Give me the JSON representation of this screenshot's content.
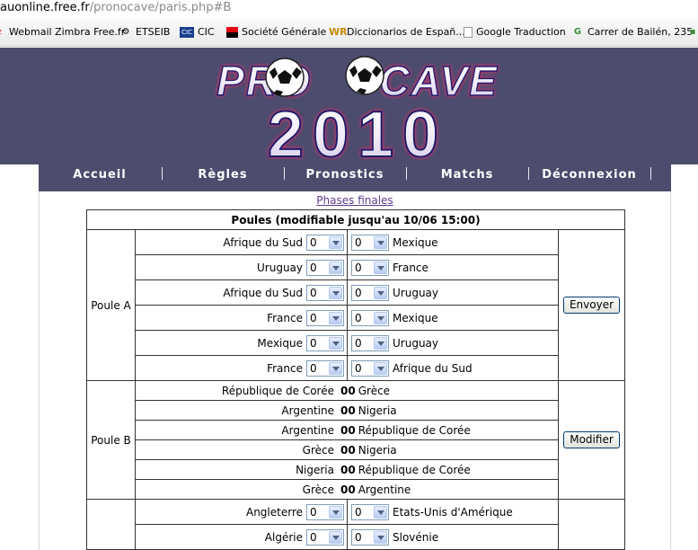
{
  "browser": {
    "url_host": "auonline.free.fr",
    "url_path": "/pronocave/paris.php#B",
    "bookmarks": [
      {
        "label": "Webmail Zimbra Free.fr",
        "icon": "zimbra-icon"
      },
      {
        "label": "ETSEIB",
        "icon": "etseib-icon"
      },
      {
        "label": "CIC",
        "icon": "cic-icon"
      },
      {
        "label": "Société Générale",
        "icon": "societe-generale-icon"
      },
      {
        "label": "Diccionarios de Españ...",
        "icon": "wr-icon"
      },
      {
        "label": "Google Traduction",
        "icon": "page-icon"
      },
      {
        "label": "Carrer de Bailén, 235",
        "icon": "maps-icon"
      }
    ]
  },
  "logo": {
    "line1": "PRONOCAVE",
    "line2": "2010"
  },
  "nav": [
    "Accueil",
    "Règles",
    "Pronostics",
    "Matchs",
    "Déconnexion"
  ],
  "phases_link": "Phases finales",
  "table": {
    "header": "Poules (modifiable jusqu'au 10/06 15:00)",
    "groups": [
      {
        "name": "Poule A",
        "button": "Envoyer",
        "editable": true,
        "matches": [
          {
            "home": "Afrique du Sud",
            "away": "Mexique",
            "h": "0",
            "a": "0"
          },
          {
            "home": "Uruguay",
            "away": "France",
            "h": "0",
            "a": "0"
          },
          {
            "home": "Afrique du Sud",
            "away": "Uruguay",
            "h": "0",
            "a": "0"
          },
          {
            "home": "France",
            "away": "Mexique",
            "h": "0",
            "a": "0"
          },
          {
            "home": "Mexique",
            "away": "Uruguay",
            "h": "0",
            "a": "0"
          },
          {
            "home": "France",
            "away": "Afrique du Sud",
            "h": "0",
            "a": "0"
          }
        ]
      },
      {
        "name": "Poule B",
        "button": "Modifier",
        "editable": false,
        "matches": [
          {
            "home": "République de Corée",
            "away": "Grèce",
            "h": "0",
            "a": "0"
          },
          {
            "home": "Argentine",
            "away": "Nigeria",
            "h": "0",
            "a": "0"
          },
          {
            "home": "Argentine",
            "away": "République de Corée",
            "h": "0",
            "a": "0"
          },
          {
            "home": "Grèce",
            "away": "Nigeria",
            "h": "0",
            "a": "0"
          },
          {
            "home": "Nigeria",
            "away": "République de Corée",
            "h": "0",
            "a": "0"
          },
          {
            "home": "Grèce",
            "away": "Argentine",
            "h": "0",
            "a": "0"
          }
        ]
      },
      {
        "name": "",
        "button": "",
        "editable": true,
        "matches": [
          {
            "home": "Angleterre",
            "away": "Etats-Unis d'Amérique",
            "h": "0",
            "a": "0"
          },
          {
            "home": "Algérie",
            "away": "Slovénie",
            "h": "0",
            "a": "0"
          }
        ]
      }
    ]
  },
  "colors": {
    "banner": "#4c4c6e",
    "link": "#5d3a8a"
  }
}
